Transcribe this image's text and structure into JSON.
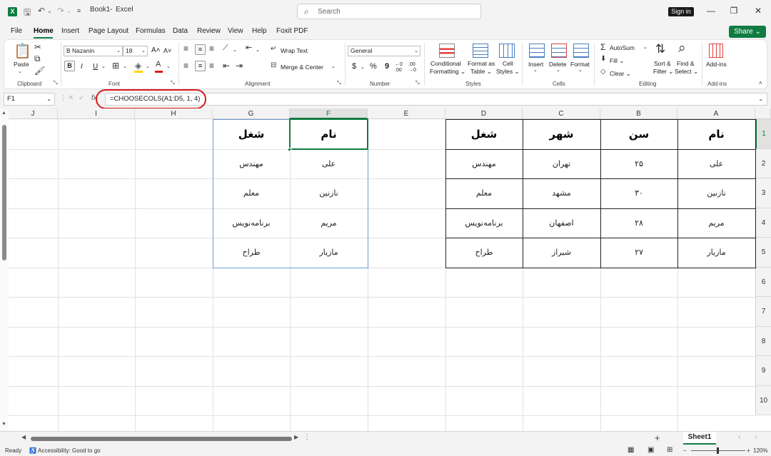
{
  "titlebar": {
    "logo": "X",
    "workbook": "Book1",
    "separator": "-",
    "app": "Excel",
    "search_placeholder": "Search",
    "sign_in": "Sign in"
  },
  "menu": {
    "items": [
      "File",
      "Home",
      "Insert",
      "Page Layout",
      "Formulas",
      "Data",
      "Review",
      "View",
      "Help",
      "Foxit PDF"
    ],
    "active": "Home",
    "share": "Share"
  },
  "ribbon": {
    "clipboard": {
      "paste": "Paste",
      "label": "Clipboard"
    },
    "font": {
      "name": "B Nazanin",
      "size": "18",
      "grow": "A",
      "shrink": "A",
      "bold": "B",
      "italic": "I",
      "underline": "U",
      "label": "Font"
    },
    "alignment": {
      "wrap": "Wrap Text",
      "merge": "Merge & Center",
      "label": "Alignment"
    },
    "number": {
      "format": "General",
      "currency": "$",
      "percent": "%",
      "comma": "9",
      "inc_dec": "←0 .00",
      "dec_dec": ".00 →0",
      "label": "Number"
    },
    "styles": {
      "conditional_1": "Conditional",
      "conditional_2": "Formatting",
      "format_table_1": "Format as",
      "format_table_2": "Table",
      "cell_styles_1": "Cell",
      "cell_styles_2": "Styles",
      "label": "Styles"
    },
    "cells": {
      "insert": "Insert",
      "delete": "Delete",
      "format": "Format",
      "label": "Cells"
    },
    "editing": {
      "autosum": "AutoSum",
      "fill": "Fill",
      "clear": "Clear",
      "sort_1": "Sort &",
      "sort_2": "Filter",
      "find_1": "Find &",
      "find_2": "Select",
      "label": "Editing"
    },
    "addins": {
      "addins": "Add-ins",
      "label": "Add-ins"
    }
  },
  "formula_bar": {
    "name_box": "F1",
    "fx": "fx",
    "formula": "=CHOOSECOLS(A1:D5, 1, 4)"
  },
  "grid": {
    "columns": [
      "J",
      "I",
      "H",
      "G",
      "F",
      "E",
      "D",
      "C",
      "B",
      "A"
    ],
    "rows": [
      "1",
      "2",
      "3",
      "4",
      "5",
      "6",
      "7",
      "8",
      "9",
      "10"
    ],
    "source_table": {
      "headers": [
        "نام",
        "سن",
        "شهر",
        "شغل"
      ],
      "rows": [
        [
          "علی",
          "۲۵",
          "تهران",
          "مهندس"
        ],
        [
          "نازنین",
          "۳۰",
          "مشهد",
          "معلم"
        ],
        [
          "مریم",
          "۲۸",
          "اصفهان",
          "برنامه‌نویس"
        ],
        [
          "مازیار",
          "۲۷",
          "شیراز",
          "طراح"
        ]
      ]
    },
    "result_table": {
      "headers": [
        "نام",
        "شغل"
      ],
      "rows": [
        [
          "علی",
          "مهندس"
        ],
        [
          "نازنین",
          "معلم"
        ],
        [
          "مریم",
          "برنامه‌نویس"
        ],
        [
          "مازیار",
          "طراح"
        ]
      ]
    }
  },
  "sheets": {
    "active": "Sheet1",
    "add": "+"
  },
  "status": {
    "ready": "Ready",
    "accessibility": "Accessibility: Good to go",
    "zoom": "120%"
  },
  "colors": {
    "accent": "#107c41",
    "highlight": "#d8191c"
  }
}
